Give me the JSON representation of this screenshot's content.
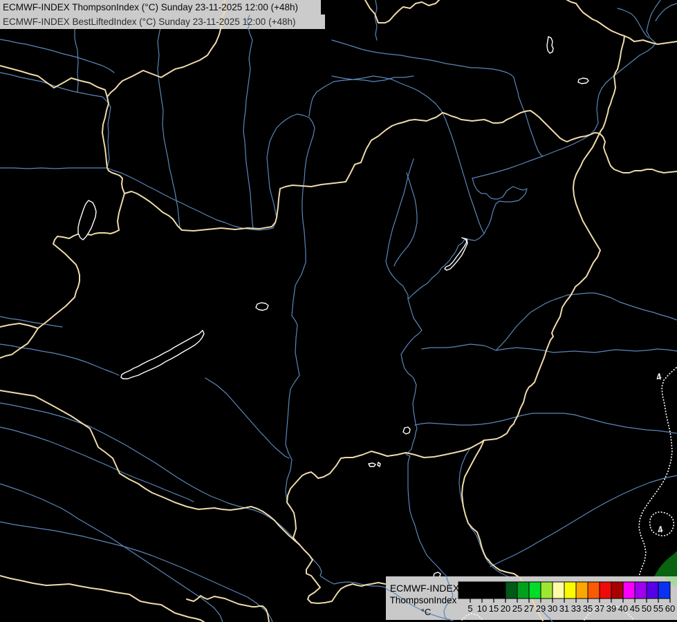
{
  "title": {
    "line1": "ECMWF-INDEX ThompsonIndex (°C) Sunday 23-11-2025 12:00 (+48h)",
    "line2": "ECMWF-INDEX BestLiftedIndex (°C) Sunday 23-11-2025 12:00 (+48h)"
  },
  "legend": {
    "heading": "ECMWF-INDEX",
    "subheading": "ThompsonIndex",
    "unit": "°C",
    "colorbar": {
      "tick_labels": [
        "5",
        "10",
        "15",
        "20",
        "25",
        "27",
        "29",
        "30",
        "31",
        "33",
        "35",
        "37",
        "39",
        "40",
        "45",
        "50",
        "55",
        "60"
      ],
      "segment_colors": [
        "#000000",
        "#000000",
        "#000000",
        "#000000",
        "#00591a",
        "#00a01e",
        "#00dc28",
        "#9ee632",
        "#fbfbaa",
        "#fbfb00",
        "#fca800",
        "#fa5a00",
        "#f00a0a",
        "#a80000",
        "#fa00fa",
        "#a000f0",
        "#5500e6",
        "#0a32f5"
      ]
    }
  },
  "contours": {
    "labels": [
      "4",
      "4"
    ]
  },
  "colors": {
    "background": "#000000",
    "border": "#efdbab",
    "river": "#5b87ba",
    "lake_outline": "#ffffff",
    "contour": "#ffffff",
    "title_bg": "#cbcbcb",
    "title_text": "#0a0a0a",
    "title_text2": "#2e2e2e",
    "legend_bg": "#c9c9c9",
    "legend_text": "#000000",
    "shaded_patch_dark": "#096311",
    "shaded_patch_light": "#a8d7a0"
  }
}
